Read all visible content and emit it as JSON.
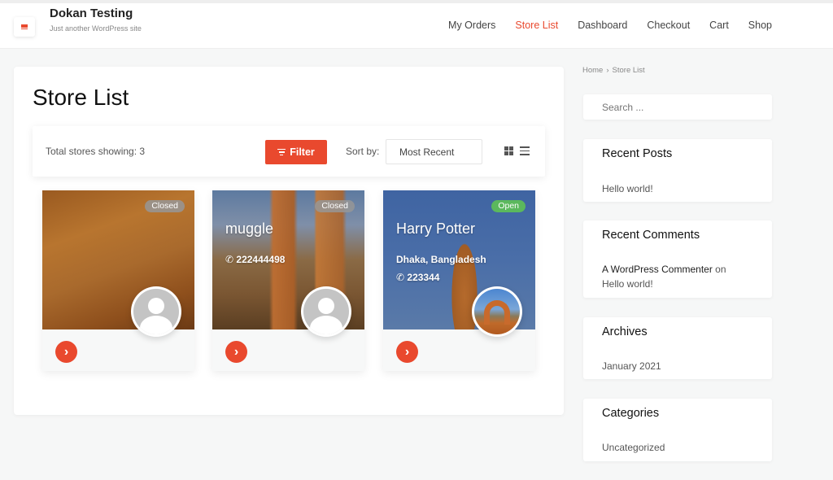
{
  "site": {
    "title": "Dokan Testing",
    "description": "Just another WordPress site"
  },
  "nav": {
    "items": [
      {
        "label": "My Orders",
        "active": false
      },
      {
        "label": "Store List",
        "active": true
      },
      {
        "label": "Dashboard",
        "active": false
      },
      {
        "label": "Checkout",
        "active": false
      },
      {
        "label": "Cart",
        "active": false
      },
      {
        "label": "Shop",
        "active": false
      }
    ]
  },
  "colors": {
    "accent": "#e9492e",
    "open_badge": "#5bb85d",
    "closed_badge": "#969696"
  },
  "main": {
    "page_title": "Store List",
    "toolbar": {
      "total_label": "Total stores showing: 3",
      "filter_label": "Filter",
      "sort_label": "Sort by:",
      "sort_value": "Most Recent",
      "view_grid_icon": "grid-view-icon",
      "view_list_icon": "list-view-icon"
    },
    "stores": [
      {
        "name": "",
        "status": "Closed",
        "address": "",
        "phone": "",
        "avatar": "default-avatar"
      },
      {
        "name": "muggle",
        "status": "Closed",
        "address": "",
        "phone": "222444498",
        "avatar": "default-avatar"
      },
      {
        "name": "Harry Potter",
        "status": "Open",
        "address": "Dhaka, Bangladesh",
        "phone": "223344",
        "avatar": "store-logo-photo"
      }
    ]
  },
  "sidebar": {
    "breadcrumb": {
      "home": "Home",
      "separator": "›",
      "current": "Store List"
    },
    "search_placeholder": "Search ...",
    "recent_posts": {
      "title": "Recent Posts",
      "items": [
        "Hello world!"
      ]
    },
    "recent_comments": {
      "title": "Recent Comments",
      "author": "A WordPress Commenter",
      "on": "on",
      "post": "Hello world!"
    },
    "archives": {
      "title": "Archives",
      "items": [
        "January 2021"
      ]
    },
    "categories": {
      "title": "Categories",
      "items": [
        "Uncategorized"
      ]
    }
  }
}
